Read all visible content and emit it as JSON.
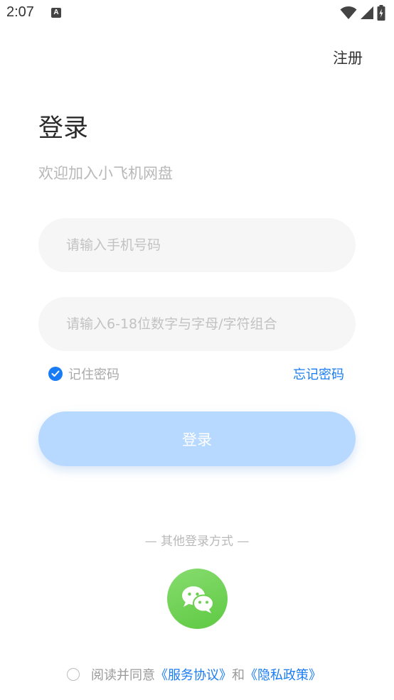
{
  "status_bar": {
    "time": "2:07",
    "notification_icon_letter": "A",
    "icons": [
      "notification-a-icon",
      "wifi-icon",
      "signal-icon",
      "battery-charging-icon"
    ]
  },
  "header": {
    "register_label": "注册"
  },
  "main": {
    "title": "登录",
    "subtitle": "欢迎加入小飞机网盘",
    "phone_placeholder": "请输入手机号码",
    "password_placeholder": "请输入6-18位数字与字母/字符组合",
    "remember_label": "记住密码",
    "remember_checked": true,
    "forgot_label": "忘记密码",
    "login_label": "登录",
    "login_button_color": "#b7d9ff",
    "accent_color": "#1a7cf5"
  },
  "other_login": {
    "label": "— 其他登录方式 —",
    "wechat_icon": "wechat-icon",
    "wechat_color": "#6bd050"
  },
  "agreement": {
    "prefix": "阅读并同意",
    "service_link": "《服务协议》",
    "and_text": "和",
    "privacy_link": "《隐私政策》",
    "checked": false
  }
}
